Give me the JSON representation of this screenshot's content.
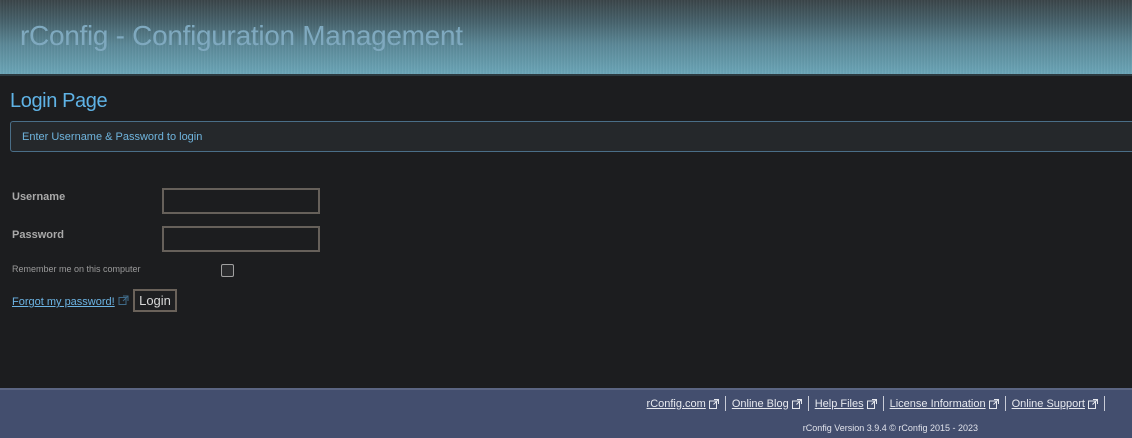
{
  "header": {
    "app_title": "rConfig - Configuration Management"
  },
  "main": {
    "page_title": "Login Page",
    "info_message": "Enter Username & Password to login",
    "form": {
      "username_label": "Username",
      "username_value": "",
      "password_label": "Password",
      "password_value": "",
      "remember_label": "Remember me on this computer",
      "remember_checked": false,
      "forgot_link": "Forgot my password!",
      "login_button": "Login"
    }
  },
  "footer": {
    "links": [
      {
        "label": "rConfig.com",
        "icon": "external-link-icon"
      },
      {
        "label": "Online Blog",
        "icon": "external-link-icon"
      },
      {
        "label": "Help Files",
        "icon": "external-link-icon"
      },
      {
        "label": "License Information",
        "icon": "external-link-icon"
      },
      {
        "label": "Online Support",
        "icon": "external-link-icon"
      }
    ],
    "version_text": "rConfig Version 3.9.4   © rConfig 2015 - 2023"
  },
  "colors": {
    "page_title": "#5fb3e6",
    "footer_bg": "#434e6e",
    "header_accent": "#6aa5b7"
  }
}
